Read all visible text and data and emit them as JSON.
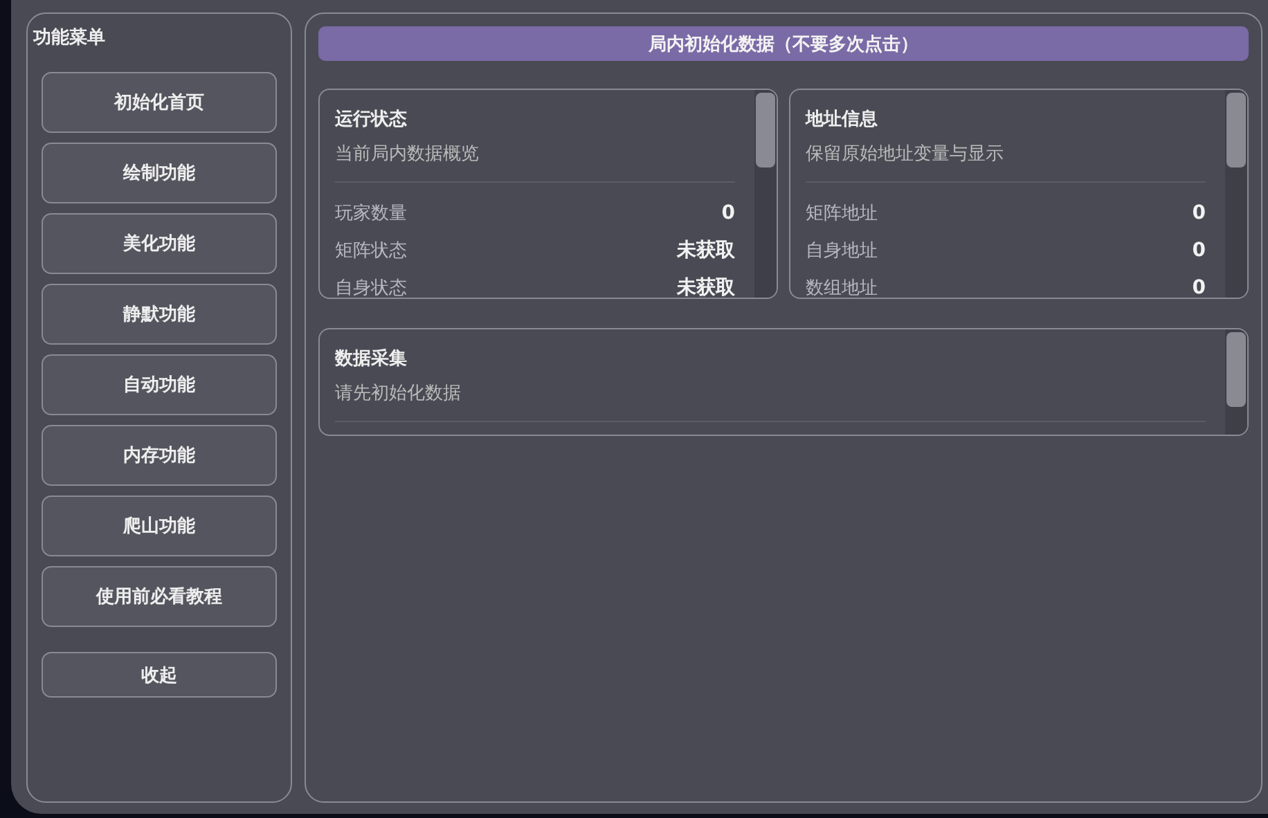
{
  "sidebar": {
    "title": "功能菜单",
    "items": [
      {
        "label": "初始化首页"
      },
      {
        "label": "绘制功能"
      },
      {
        "label": "美化功能"
      },
      {
        "label": "静默功能"
      },
      {
        "label": "自动功能"
      },
      {
        "label": "内存功能"
      },
      {
        "label": "爬山功能"
      },
      {
        "label": "使用前必看教程"
      }
    ],
    "collapse_button": "收起"
  },
  "main": {
    "init_button": "局内初始化数据（不要多次点击）",
    "cards": [
      {
        "title": "运行状态",
        "subtitle": "当前局内数据概览",
        "rows": [
          {
            "label": "玩家数量",
            "value": "0"
          },
          {
            "label": "矩阵状态",
            "value": "未获取"
          },
          {
            "label": "自身状态",
            "value": "未获取"
          }
        ]
      },
      {
        "title": "地址信息",
        "subtitle": "保留原始地址变量与显示",
        "rows": [
          {
            "label": "矩阵地址",
            "value": "0"
          },
          {
            "label": "自身地址",
            "value": "0"
          },
          {
            "label": "数组地址",
            "value": "0"
          }
        ]
      }
    ],
    "collect_card": {
      "title": "数据采集",
      "subtitle": "请先初始化数据"
    }
  }
}
